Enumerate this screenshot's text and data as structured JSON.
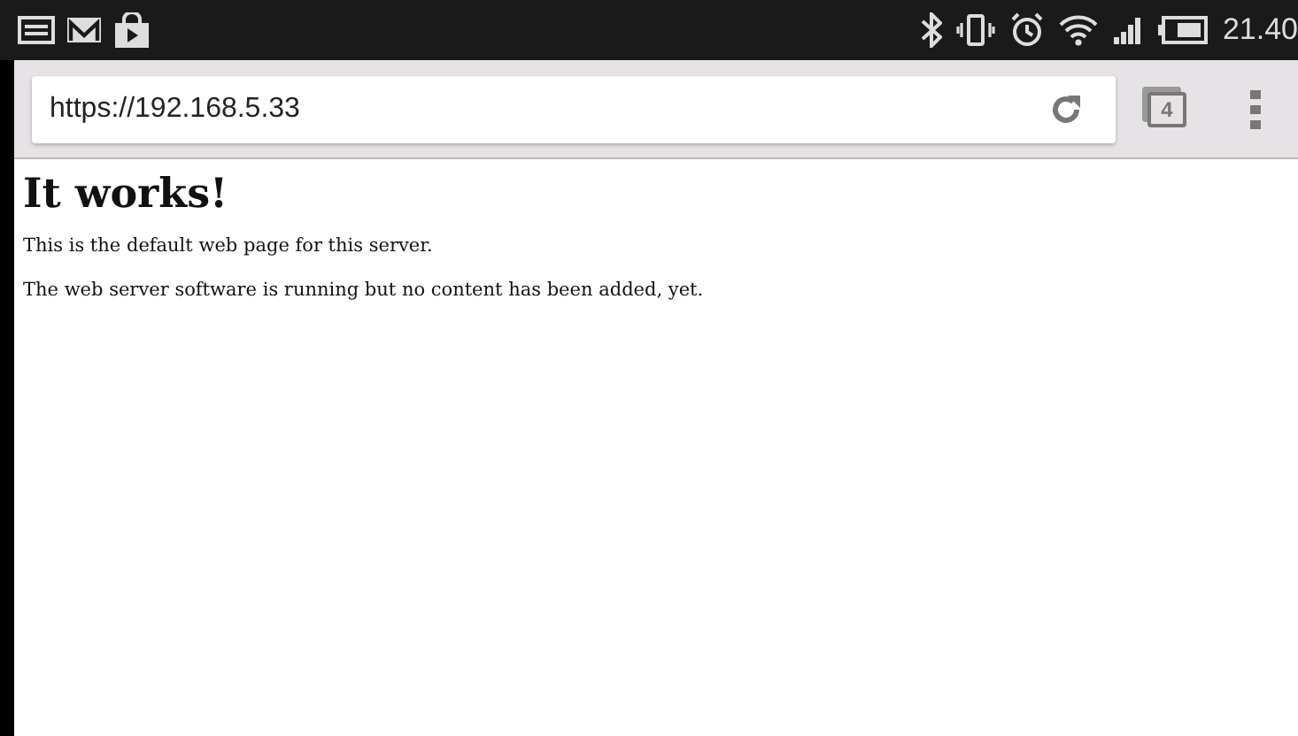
{
  "status_bar": {
    "time": "21.40"
  },
  "browser": {
    "url": "https://192.168.5.33",
    "tab_count": "4"
  },
  "page": {
    "heading": "It works!",
    "paragraphs": [
      "This is the default web page for this server.",
      "The web server software is running but no content has been added, yet."
    ]
  }
}
